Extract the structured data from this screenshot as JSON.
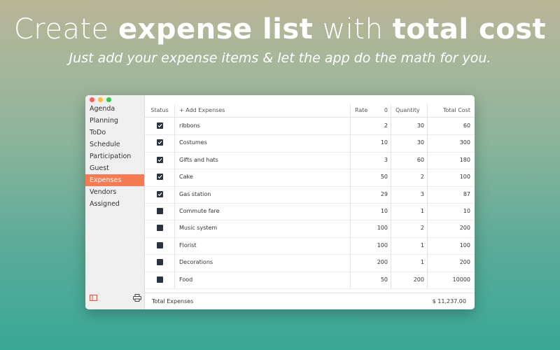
{
  "hero": {
    "title_pre": "Create ",
    "title_bold1": "expense list",
    "title_mid": " with ",
    "title_bold2": "total cost",
    "subtitle": "Just add your expense items & let the app do the math for you."
  },
  "sidebar": {
    "items": [
      {
        "label": "Agenda"
      },
      {
        "label": "Planning"
      },
      {
        "label": "ToDo"
      },
      {
        "label": "Schedule"
      },
      {
        "label": "Participation"
      },
      {
        "label": "Guest"
      },
      {
        "label": "Expenses"
      },
      {
        "label": "Vendors"
      },
      {
        "label": "Assigned"
      }
    ],
    "active_index": 6,
    "active_color": "#f47b52",
    "bottom_icons": [
      "sidebar-toggle-icon",
      "print-icon"
    ]
  },
  "table": {
    "headers": {
      "status": "Status",
      "name": "+ Add Expenses",
      "rate": "Rate",
      "rate_extra": "0",
      "quantity": "Quantity",
      "total": "Total Cost"
    },
    "rows": [
      {
        "checked": true,
        "name": "ribbons",
        "rate": "2",
        "quantity": "30",
        "total": "60"
      },
      {
        "checked": true,
        "name": "Costumes",
        "rate": "10",
        "quantity": "30",
        "total": "300"
      },
      {
        "checked": true,
        "name": "Gifts and hats",
        "rate": "3",
        "quantity": "60",
        "total": "180"
      },
      {
        "checked": true,
        "name": "Cake",
        "rate": "50",
        "quantity": "2",
        "total": "100"
      },
      {
        "checked": true,
        "name": "Gas station",
        "rate": "29",
        "quantity": "3",
        "total": "87"
      },
      {
        "checked": false,
        "name": "Commute fare",
        "rate": "10",
        "quantity": "1",
        "total": "10"
      },
      {
        "checked": false,
        "name": "Music system",
        "rate": "100",
        "quantity": "2",
        "total": "200"
      },
      {
        "checked": false,
        "name": "Florist",
        "rate": "100",
        "quantity": "1",
        "total": "100"
      },
      {
        "checked": false,
        "name": "Decorations",
        "rate": "200",
        "quantity": "1",
        "total": "200"
      },
      {
        "checked": false,
        "name": "Food",
        "rate": "50",
        "quantity": "200",
        "total": "10000"
      }
    ]
  },
  "footer": {
    "label": "Total Expenses",
    "amount": "$ 11,237.00"
  }
}
